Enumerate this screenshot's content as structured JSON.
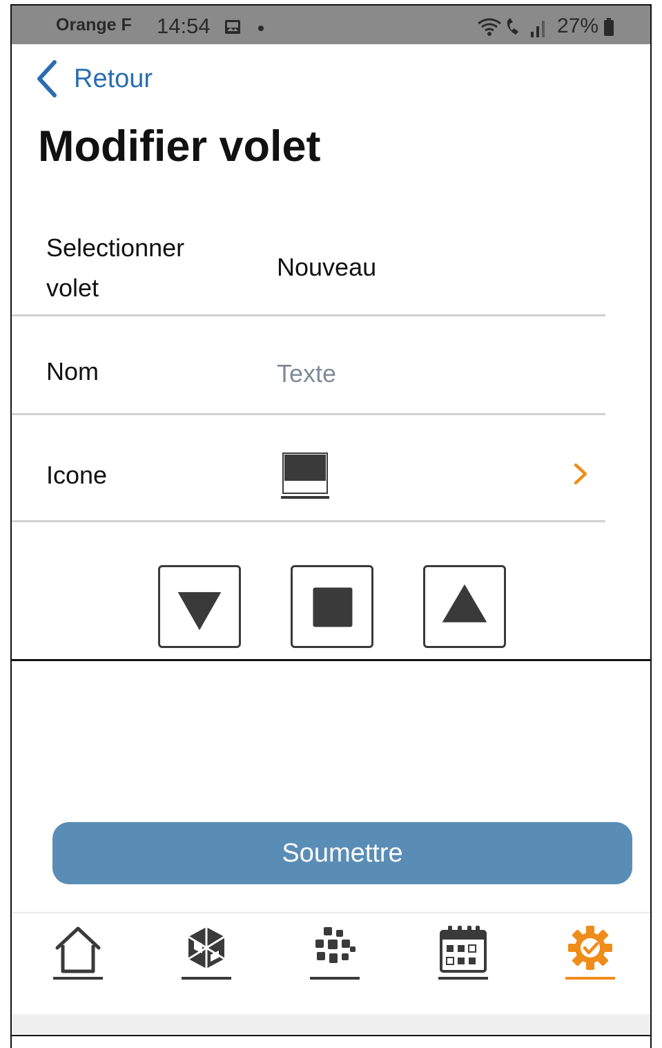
{
  "status_bar": {
    "carrier": "Orange F",
    "time": "14:54",
    "battery": "27%"
  },
  "header": {
    "back_label": "Retour",
    "title": "Modifier volet"
  },
  "form": {
    "select": {
      "label": "Selectionner volet",
      "value": "Nouveau"
    },
    "name": {
      "label": "Nom",
      "placeholder": "Texte"
    },
    "icon": {
      "label": "Icone",
      "icon_name": "shutter-icon"
    }
  },
  "controls": [
    {
      "name": "down",
      "icon": "triangle-down-icon"
    },
    {
      "name": "stop",
      "icon": "square-stop-icon"
    },
    {
      "name": "up",
      "icon": "triangle-up-icon"
    }
  ],
  "submit_label": "Soumettre",
  "nav": {
    "items": [
      {
        "icon": "home-icon",
        "active": false
      },
      {
        "icon": "cube-devices-icon",
        "active": false
      },
      {
        "icon": "scenes-grid-icon",
        "active": false
      },
      {
        "icon": "calendar-icon",
        "active": false
      },
      {
        "icon": "gear-icon",
        "active": true
      }
    ]
  },
  "colors": {
    "accent": "#f08c1a",
    "link": "#2a6db0",
    "submit_bg": "#5a8db6",
    "icon_dark": "#3a3a3a"
  }
}
